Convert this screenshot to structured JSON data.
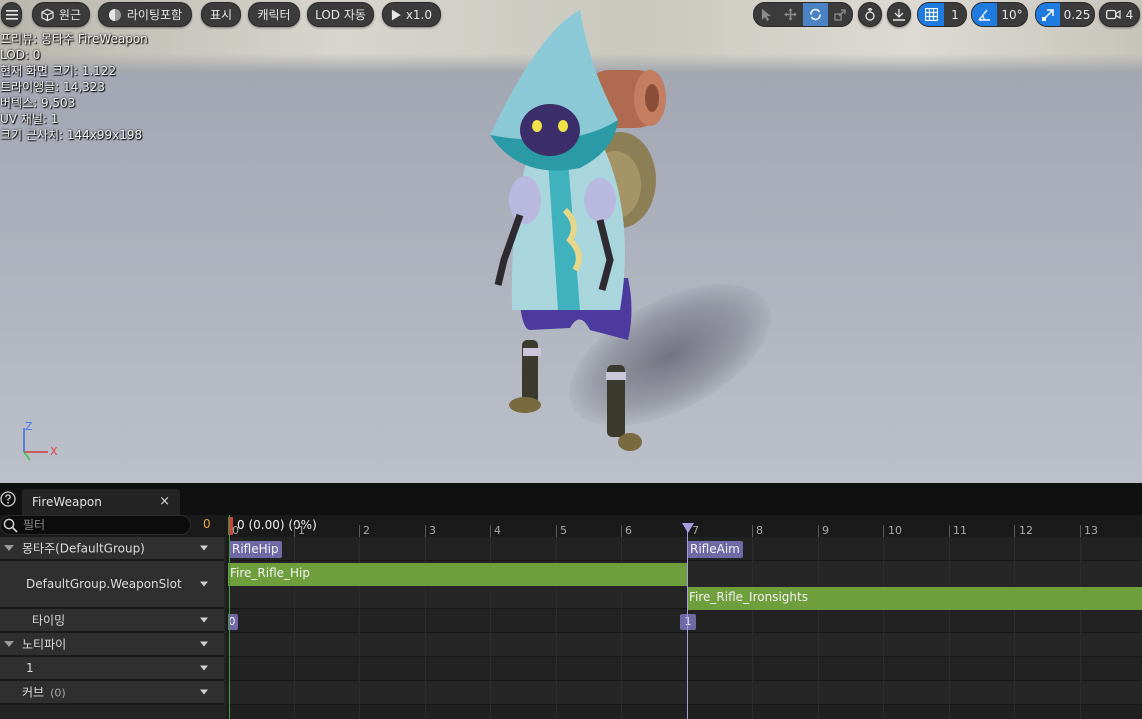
{
  "viewport": {
    "toolbar": {
      "menu_icon": "hamburger-icon",
      "perspective_label": "원근",
      "lighting_label": "라이팅포함",
      "show_label": "표시",
      "character_label": "캐릭터",
      "lod_label": "LOD 자동",
      "play_speed_label": "x1.0",
      "grid_value": "1",
      "rotation_snap_value": "10°",
      "scale_snap_value": "0.25",
      "camera_speed_value": "4"
    },
    "stats": [
      "프리뷰: 몽타주 FireWeapon",
      "LOD: 0",
      "현재 화면 크기: 1.122",
      "트라이앵글: 14,323",
      "버텍스: 9,503",
      "UV 채널: 1",
      "크기 근사치: 144x99x198"
    ],
    "axis": {
      "z": "Z",
      "x": "X"
    }
  },
  "panel": {
    "tab_label": "FireWeapon",
    "tab_close": "×",
    "filter_placeholder": "필터",
    "filter_count": "0",
    "tracks": {
      "montage_group": "몽타주(DefaultGroup)",
      "weapon_slot": "DefaultGroup.WeaponSlot",
      "timing": "타이밍",
      "notifies": "노티파이",
      "notify_track_1": "1",
      "curves": "커브",
      "curves_count": "(0)"
    },
    "timeline": {
      "frame_readout": "0 (0.00) (0%)",
      "ticks": [
        "0",
        "1",
        "2",
        "3",
        "4",
        "5",
        "6",
        "7",
        "8",
        "9",
        "10",
        "11",
        "12",
        "13"
      ],
      "sections": [
        "RifleHip",
        "RifleAim"
      ],
      "segments": [
        "Fire_Rifle_Hip",
        "Fire_Rifle_Ironsights"
      ],
      "timing_markers": [
        "0",
        "1"
      ]
    }
  },
  "colors": {
    "accent_blue": "#1f7be0",
    "section_purple": "#6f6aa6",
    "segment_green": "#6f9e3c",
    "filter_count_orange": "#e7a33e"
  }
}
